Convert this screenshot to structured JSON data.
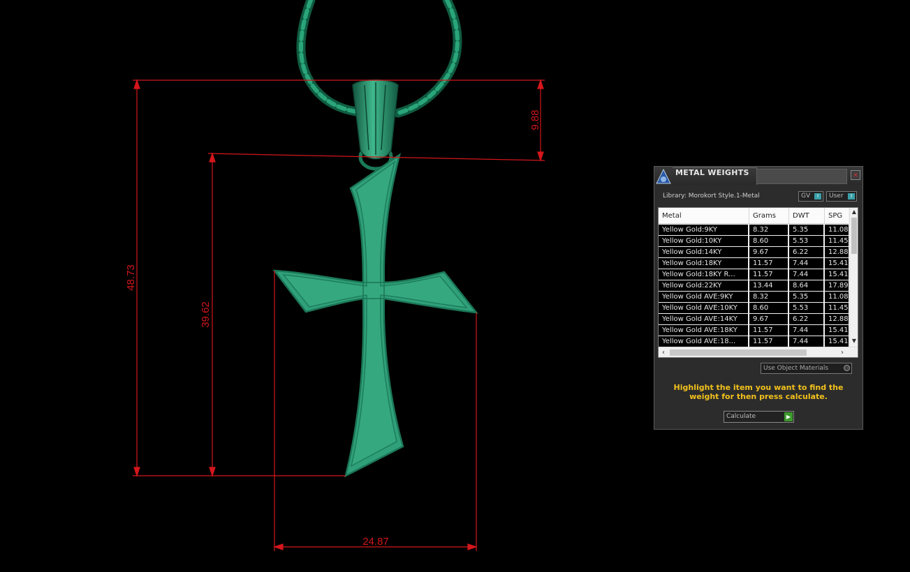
{
  "dimensions": {
    "overall_height": "48.73",
    "cross_height": "39.62",
    "bail_height": "9.88",
    "width": "24.87"
  },
  "colors": {
    "model": "#2fa07a",
    "dimension_lines": "#d4161c",
    "help_text": "#f2c11c"
  },
  "panel": {
    "title": "METAL WEIGHTS",
    "close_icon": "×",
    "library": "Library: Morokort Style.1-Metal",
    "gv_toggle": "GV",
    "user_toggle": "User",
    "columns": [
      "Metal",
      "Grams",
      "DWT",
      "SPG"
    ],
    "rows": [
      [
        "Yellow Gold:9KY",
        "8.32",
        "5.35",
        "11.08"
      ],
      [
        "Yellow Gold:10KY",
        "8.60",
        "5.53",
        "11.45"
      ],
      [
        "Yellow Gold:14KY",
        "9.67",
        "6.22",
        "12.88"
      ],
      [
        "Yellow Gold:18KY",
        "11.57",
        "7.44",
        "15.41"
      ],
      [
        "Yellow Gold:18KY R...",
        "11.57",
        "7.44",
        "15.41"
      ],
      [
        "Yellow Gold:22KY",
        "13.44",
        "8.64",
        "17.89"
      ],
      [
        "Yellow Gold AVE:9KY",
        "8.32",
        "5.35",
        "11.08"
      ],
      [
        "Yellow Gold AVE:10KY",
        "8.60",
        "5.53",
        "11.45"
      ],
      [
        "Yellow Gold AVE:14KY",
        "9.67",
        "6.22",
        "12.88"
      ],
      [
        "Yellow Gold AVE:18KY",
        "11.57",
        "7.44",
        "15.41"
      ],
      [
        "Yellow Gold AVE:18...",
        "11.57",
        "7.44",
        "15.41"
      ]
    ],
    "use_object_materials": "Use Object Materials",
    "help_text": "Highlight the item you want to find the weight for then press calculate.",
    "calculate_label": "Calculate"
  }
}
